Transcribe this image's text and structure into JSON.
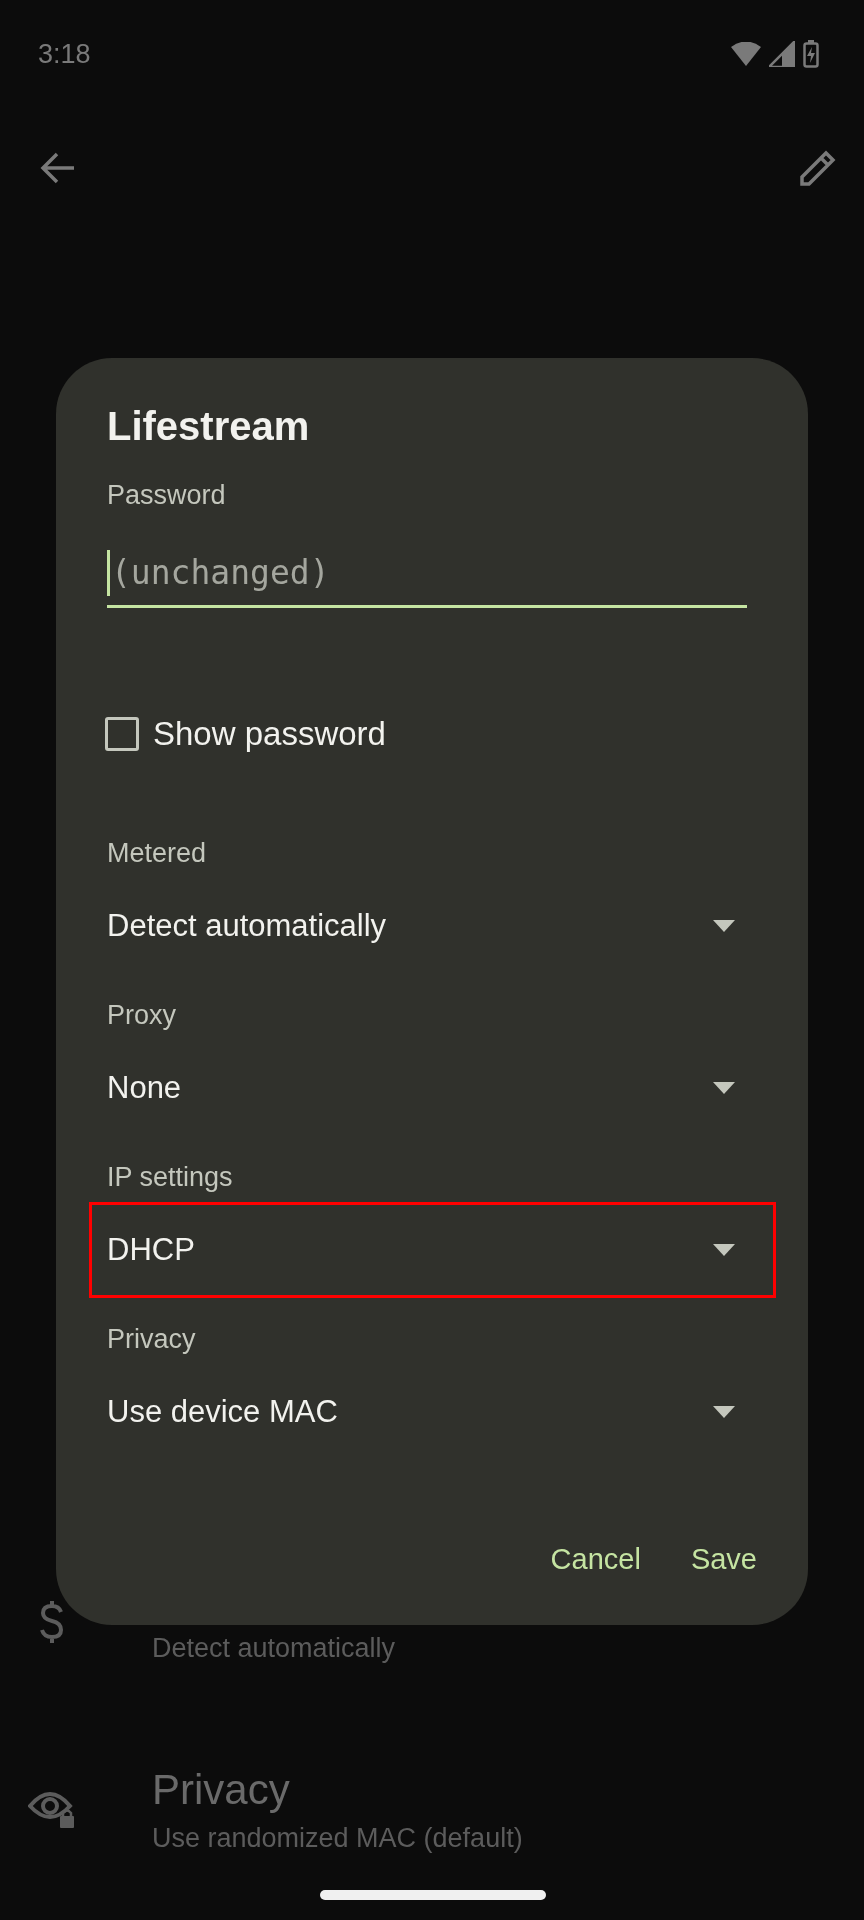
{
  "status_bar": {
    "time": "3:18"
  },
  "background": {
    "items": [
      {
        "kind": "metered",
        "subtitle": "Detect automatically"
      },
      {
        "kind": "privacy",
        "title": "Privacy",
        "subtitle": "Use randomized MAC (default)"
      }
    ]
  },
  "dialog": {
    "title": "Lifestream",
    "password": {
      "label": "Password",
      "placeholder": "(unchanged)",
      "focused": true
    },
    "show_password": {
      "label": "Show password",
      "checked": false
    },
    "fields": [
      {
        "label": "Metered",
        "value": "Detect automatically",
        "highlighted": false
      },
      {
        "label": "Proxy",
        "value": "None",
        "highlighted": false
      },
      {
        "label": "IP settings",
        "value": "DHCP",
        "highlighted": true
      },
      {
        "label": "Privacy",
        "value": "Use device MAC",
        "highlighted": false
      }
    ],
    "buttons": [
      "Cancel",
      "Save"
    ]
  }
}
